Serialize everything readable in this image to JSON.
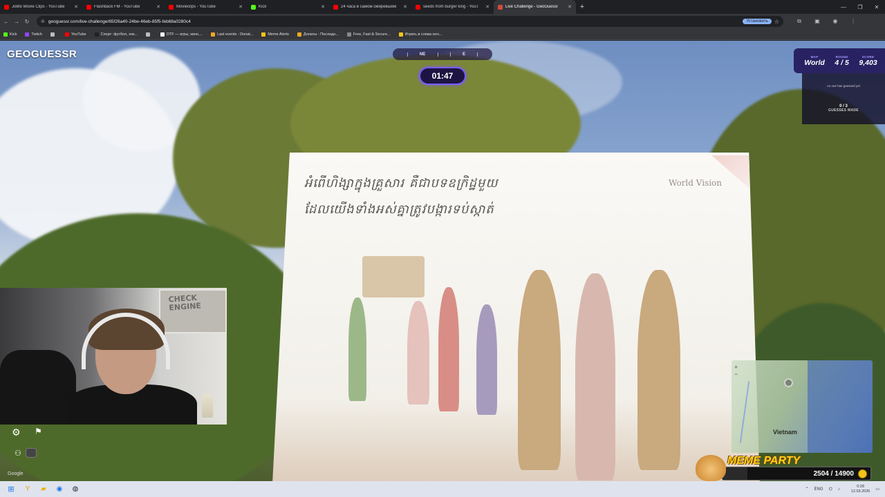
{
  "browser": {
    "tabs": [
      {
        "title": "JoBlo Movie Clips - YouTube",
        "color": "#ff0000",
        "active": false
      },
      {
        "title": "Flashback FM - YouTube",
        "color": "#ff0000",
        "active": false
      },
      {
        "title": "Movieclips - YouTube",
        "color": "#ff0000",
        "active": false
      },
      {
        "title": "Kick",
        "color": "#53fc18",
        "active": false
      },
      {
        "title": "24 часа в самом ожиревшем",
        "color": "#ff0000",
        "active": false
      },
      {
        "title": "seeds from burger king - YouT",
        "color": "#ff0000",
        "active": false
      },
      {
        "title": "Live Challenge - GeoGuessr",
        "color": "#d64a3b",
        "active": true
      }
    ],
    "new_tab": "+",
    "url": "geoguessr.com/live-challenge/65f26a40-24be-46eb-85f5-feb68a0280c4",
    "install_label": "Установить",
    "bookmarks": [
      {
        "label": "Kick",
        "color": "#53fc18"
      },
      {
        "label": "Twitch",
        "color": "#9146ff"
      },
      {
        "label": "",
        "color": "#bbbbbb"
      },
      {
        "label": "YouTube",
        "color": "#ff0000"
      },
      {
        "label": "Спорт: футбол, хок...",
        "color": "#222222"
      },
      {
        "label": "",
        "color": "#bbbbbb"
      },
      {
        "label": "DTF — игры, кино,...",
        "color": "#ffffff"
      },
      {
        "label": "Last events - Donat...",
        "color": "#f5a623"
      },
      {
        "label": "Meme Alerts",
        "color": "#f5c518"
      },
      {
        "label": "Донаты - Последн...",
        "color": "#f5a623"
      },
      {
        "label": "Free, Fast & Secure...",
        "color": "#888888"
      },
      {
        "label": "Играть в слова онл...",
        "color": "#f5c518"
      }
    ]
  },
  "game": {
    "logo": "GEOGUESSR",
    "compass": [
      "NE",
      "E"
    ],
    "timer": "01:47",
    "score_panel": {
      "map_label": "MAP",
      "map_value": "World",
      "round_label": "ROUND",
      "round_value": "4 / 5",
      "score_label": "SCORE",
      "score_value": "9,403"
    },
    "guess_panel": {
      "no_one": "no one has guessed yet",
      "count": "0 / 3",
      "made_label": "GUESSES MADE"
    },
    "google_mark": "Google"
  },
  "billboard": {
    "khmer_line1": "អំពើហិង្សាក្នុងគ្រួសារ គឺជាបទឧក្រិដ្ឋមួយ",
    "khmer_line2": "ដែលយើងទាំងអស់គ្នាត្រូវបង្ការទប់ស្កាត់",
    "brand": "World Vision"
  },
  "webcam": {
    "poster_text_1": "CHECK",
    "poster_text_2": "ENGINE"
  },
  "minimap": {
    "label": "Vietnam",
    "zoom_in": "+",
    "zoom_out": "−"
  },
  "meme_party": {
    "title": "MEME PARTY",
    "count": "2504 / 14900",
    "progress": 0.168
  },
  "taskbar": {
    "lang": "ENG",
    "time": "0:28",
    "date": "12.03.2026"
  }
}
